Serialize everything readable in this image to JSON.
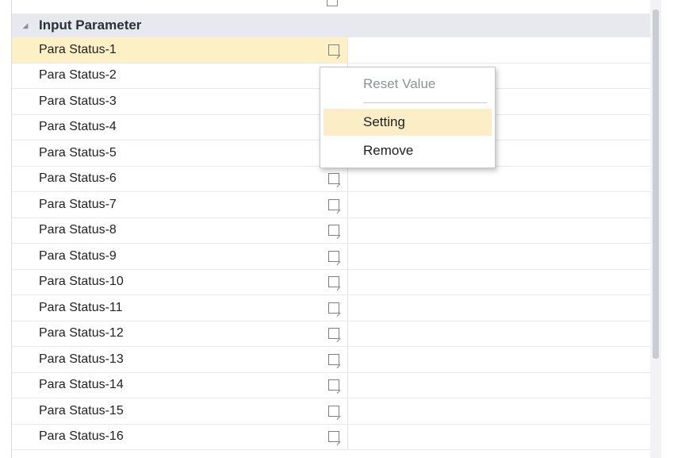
{
  "category": {
    "title": "Input Parameter"
  },
  "rows": [
    {
      "label": "Para Status-1"
    },
    {
      "label": "Para Status-2"
    },
    {
      "label": "Para Status-3"
    },
    {
      "label": "Para Status-4"
    },
    {
      "label": "Para Status-5"
    },
    {
      "label": "Para Status-6"
    },
    {
      "label": "Para Status-7"
    },
    {
      "label": "Para Status-8"
    },
    {
      "label": "Para Status-9"
    },
    {
      "label": "Para Status-10"
    },
    {
      "label": "Para Status-11"
    },
    {
      "label": "Para Status-12"
    },
    {
      "label": "Para Status-13"
    },
    {
      "label": "Para Status-14"
    },
    {
      "label": "Para Status-15"
    },
    {
      "label": "Para Status-16"
    }
  ],
  "context_menu": {
    "items": [
      {
        "label": "Reset Value",
        "enabled": false
      },
      {
        "label": "Setting",
        "enabled": true
      },
      {
        "label": "Remove",
        "enabled": true
      }
    ]
  },
  "icons": {
    "expander": "collapse-triangle-icon",
    "row_action": "edit-icon"
  },
  "colors": {
    "selected_row": "#fdf0c4",
    "category_band": "#e7e9ee",
    "menu_hover": "#fbeec7"
  }
}
